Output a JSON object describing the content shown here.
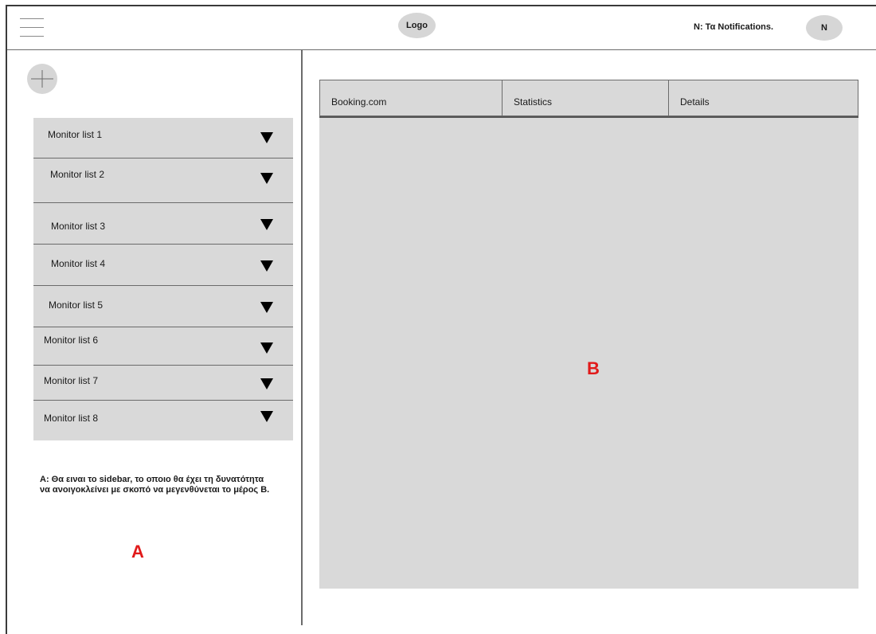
{
  "header": {
    "logo_label": "Logo",
    "notifications_text": "N: Τα Notifications.",
    "avatar_initial": "N"
  },
  "sidebar": {
    "monitor_lists": [
      {
        "label": "Monitor list 1"
      },
      {
        "label": "Monitor list 2"
      },
      {
        "label": "Monitor list 3"
      },
      {
        "label": "Monitor list 4"
      },
      {
        "label": "Monitor list 5"
      },
      {
        "label": "Monitor list 6"
      },
      {
        "label": "Monitor list 7"
      },
      {
        "label": "Monitor list 8"
      }
    ],
    "note": "A: Θα ειναι το sidebar, το οποιο θα έχει τη δυνατότητα να ανοιγοκλείνει με σκοπό να μεγενθύνεται το μέρος B.",
    "section_label": "A"
  },
  "main": {
    "tabs": [
      {
        "label": "Booking.com"
      },
      {
        "label": "Statistics"
      },
      {
        "label": "Details"
      }
    ],
    "section_label": "B"
  },
  "colors": {
    "panel_gray": "#d9d9d9",
    "accent_red": "#e11a1a"
  }
}
